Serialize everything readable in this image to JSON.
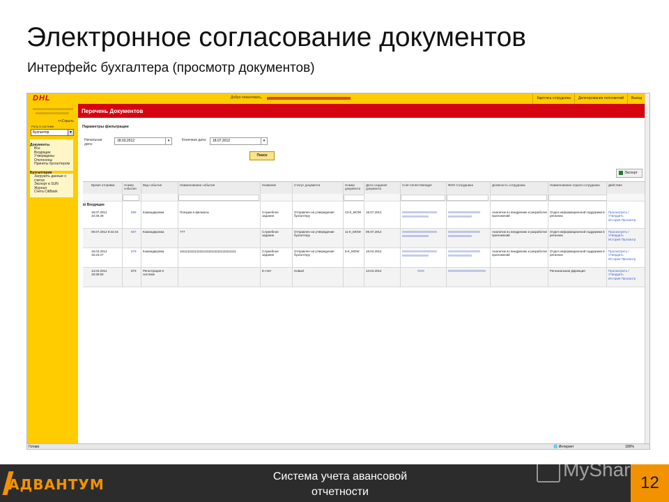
{
  "slide": {
    "title": "Электронное согласование документов",
    "subtitle": "Интерфейс бухгалтера (просмотр документов)"
  },
  "app": {
    "logo": "DHL",
    "welcome": "Добро пожаловать,",
    "topnav": [
      "Карточка сотрудника",
      "Делегирование полномочий",
      "Выход"
    ],
    "sidebar": {
      "hide": "<<Скрыть",
      "role_label": "Роль в системе",
      "role_value": "Бухгалтер",
      "sections": [
        {
          "title": "Документы",
          "items": [
            "Все",
            "Входящие",
            "Утверждены",
            "Отклонены",
            "Приняты бухгалтером"
          ]
        },
        {
          "title": "Бухгалтерия",
          "items": [
            "Загрузить данные о счетах",
            "Экспорт в SUN",
            "Журнал",
            "Счета CitiBank"
          ]
        }
      ]
    },
    "page_header": "Перечень Документов",
    "filters": {
      "title": "Параметры фильтрации",
      "start_label": "Начальная дата:",
      "start_value": "18.03.2012",
      "end_label": "Конечная дата:",
      "end_value": "18.07.2012",
      "search_button": "Поиск"
    },
    "export_button": "Экспорт",
    "table": {
      "columns": [
        "Время отправки",
        "Номер события",
        "Вид события",
        "Наименование события",
        "Название",
        "Статус документа",
        "Номер документа",
        "Дата создания документа",
        "Cost Centre Manager",
        "ФИО Сотрудника",
        "Должность сотрудника",
        "Наименование отдела сотрудника",
        "Действия"
      ],
      "group": "Входящие",
      "rows": [
        {
          "time": "18.07.2012 10:26:49",
          "num": "889",
          "kind": "Командировка",
          "event": "Поездка в филиалы",
          "name": "Служебное задание",
          "status": "Отправлен на утверждение бухгалтеру",
          "docnum": "13-К_MOW",
          "date": "18.07.2012",
          "position": "Аналитик по внедрению и разработке приложений",
          "dept": "Отдел информационной поддержки в регионах",
          "actions": "Просмотреть / Утвердить История Просмотр"
        },
        {
          "time": "09.07.2012 9:34:44",
          "num": "887",
          "kind": "Командировка",
          "event": "777",
          "name": "Служебное задание",
          "status": "Отправлен на утверждение бухгалтеру",
          "docnum": "11-К_MOW",
          "date": "09.07.2012",
          "position": "Аналитик по внедрению и разработке приложений",
          "dept": "Отдел информационной поддержки в регионах",
          "actions": "Просмотреть / Утвердить История Просмотр"
        },
        {
          "time": "18.04.2012 16:23:27",
          "num": "878",
          "kind": "Командировка",
          "event": "1111111111111111111111111111111111111",
          "name": "Служебное задание",
          "status": "Отправлен на утверждение бухгалтеру",
          "docnum": "5-К_MOW",
          "date": "18.04.2012",
          "position": "Аналитик по внедрению и разработке приложений",
          "dept": "Отдел информационной поддержки в регионах",
          "actions": "Просмотреть / Утвердить История Просмотр"
        },
        {
          "time": "13.04.2012 18:35:50",
          "num": "873",
          "kind": "Регистрация в системе",
          "event": "",
          "name": "Е-счет",
          "status": "Новый",
          "docnum": "",
          "date": "13.04.2012",
          "position": "",
          "dept": "Региональная Дирекция",
          "actions": "Просмотреть / Утвердить История Просмотр"
        }
      ]
    },
    "statusbar": {
      "left": "Готово",
      "zone": "Интернет",
      "zoom": "100%"
    }
  },
  "footer": {
    "brand": "АДВАНТУМ",
    "text": "Система учета авансовой отчетности",
    "page": "12",
    "watermark": "MyShared"
  },
  "colors": {
    "dhl_yellow": "#ffcc00",
    "dhl_red": "#d40511",
    "footer_dark": "#2c2c2c",
    "accent_orange": "#f39200"
  }
}
